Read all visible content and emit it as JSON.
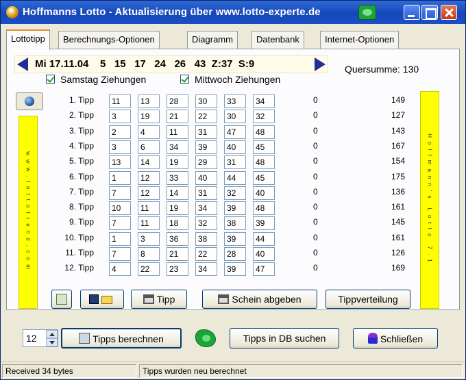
{
  "window": {
    "title": "Hoffmanns Lotto - Aktualisierung über www.lotto-experte.de"
  },
  "tabs": [
    "Lottotipp",
    "Berechnungs-Optionen",
    "Diagramm",
    "Datenbank",
    "Internet-Optionen"
  ],
  "active_tab": "Lottotipp",
  "draw": {
    "text": "Mi 17.11.04    5   15   17   24   26   43  Z:37  S:9",
    "quersumme": "Quersumme: 130",
    "checks": [
      {
        "label": "Samstag Ziehungen",
        "checked": true
      },
      {
        "label": "Mittwoch Ziehungen",
        "checked": true
      }
    ]
  },
  "banners": {
    "left": "www.lottotrend.com",
    "right": "Hoffmann's Lotto 7.1"
  },
  "tips": [
    {
      "label": "1. Tipp",
      "numbers": [
        "11",
        "13",
        "28",
        "30",
        "33",
        "34"
      ],
      "hits": "0",
      "sum": "149"
    },
    {
      "label": "2. Tipp",
      "numbers": [
        "3",
        "19",
        "21",
        "22",
        "30",
        "32"
      ],
      "hits": "0",
      "sum": "127"
    },
    {
      "label": "3. Tipp",
      "numbers": [
        "2",
        "4",
        "11",
        "31",
        "47",
        "48"
      ],
      "hits": "0",
      "sum": "143"
    },
    {
      "label": "4. Tipp",
      "numbers": [
        "3",
        "6",
        "34",
        "39",
        "40",
        "45"
      ],
      "hits": "0",
      "sum": "167"
    },
    {
      "label": "5. Tipp",
      "numbers": [
        "13",
        "14",
        "19",
        "29",
        "31",
        "48"
      ],
      "hits": "0",
      "sum": "154"
    },
    {
      "label": "6. Tipp",
      "numbers": [
        "1",
        "12",
        "33",
        "40",
        "44",
        "45"
      ],
      "hits": "0",
      "sum": "175"
    },
    {
      "label": "7. Tipp",
      "numbers": [
        "7",
        "12",
        "14",
        "31",
        "32",
        "40"
      ],
      "hits": "0",
      "sum": "136"
    },
    {
      "label": "8. Tipp",
      "numbers": [
        "10",
        "11",
        "19",
        "34",
        "39",
        "48"
      ],
      "hits": "0",
      "sum": "161"
    },
    {
      "label": "9. Tipp",
      "numbers": [
        "7",
        "11",
        "18",
        "32",
        "38",
        "39"
      ],
      "hits": "0",
      "sum": "145"
    },
    {
      "label": "10. Tipp",
      "numbers": [
        "1",
        "3",
        "36",
        "38",
        "39",
        "44"
      ],
      "hits": "0",
      "sum": "161"
    },
    {
      "label": "11. Tipp",
      "numbers": [
        "7",
        "8",
        "21",
        "22",
        "28",
        "40"
      ],
      "hits": "0",
      "sum": "126"
    },
    {
      "label": "12. Tipp",
      "numbers": [
        "4",
        "22",
        "23",
        "34",
        "39",
        "47"
      ],
      "hits": "0",
      "sum": "169"
    }
  ],
  "panel_buttons": {
    "print": "Tipp",
    "schein": "Schein abgeben",
    "verteilung": "Tippverteilung"
  },
  "bottom": {
    "count": "12",
    "berechnen": "Tipps berechnen",
    "db_suchen": "Tipps in DB suchen",
    "schliessen": "Schließen"
  },
  "status": {
    "left": "Received 34 bytes",
    "right": "Tipps wurden neu berechnet"
  },
  "colors": {
    "titlebar": "#1747b8",
    "banner": "#ffff00",
    "arrow": "#1f2f9a"
  }
}
